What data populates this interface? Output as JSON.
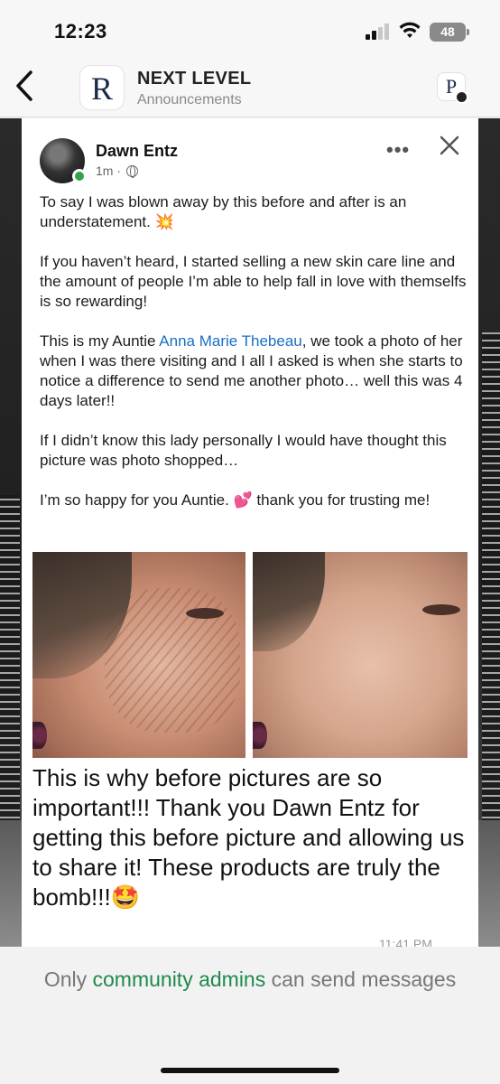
{
  "status_bar": {
    "time": "12:23",
    "battery": "48"
  },
  "header": {
    "logo_letter": "R",
    "title": "NEXT LEVEL",
    "subtitle": "Announcements",
    "profile_letter": "P"
  },
  "post": {
    "author": "Dawn Entz",
    "time": "1m",
    "time_sep": " · ",
    "more": "•••",
    "p1": "To say I was blown away by this before and after is an understatement. 💥",
    "p2": "If you haven’t heard, I started selling a new skin care line and the amount of people I’m able to help fall in love with themselfs is so rewarding!",
    "p3_before": "This is my Auntie ",
    "p3_link": "Anna Marie Thebeau",
    "p3_after": ", we took a photo of her when I was there visiting and I all I asked is when she starts to notice a difference to send me another photo… well this was 4 days later!!",
    "p4": "If I didn’t know this lady personally I would have thought this picture was photo shopped…",
    "p5": "I’m so happy for you Auntie. 💕 thank you for trusting me!"
  },
  "message": {
    "caption": "This is why before pictures are so important!!!  Thank you Dawn Entz for getting this before picture and allowing us to share it!  These products are truly the bomb!!!🤩",
    "time": "11:41 PM"
  },
  "footer": {
    "prefix": "Only ",
    "link": "community admins",
    "suffix": " can send messages"
  }
}
